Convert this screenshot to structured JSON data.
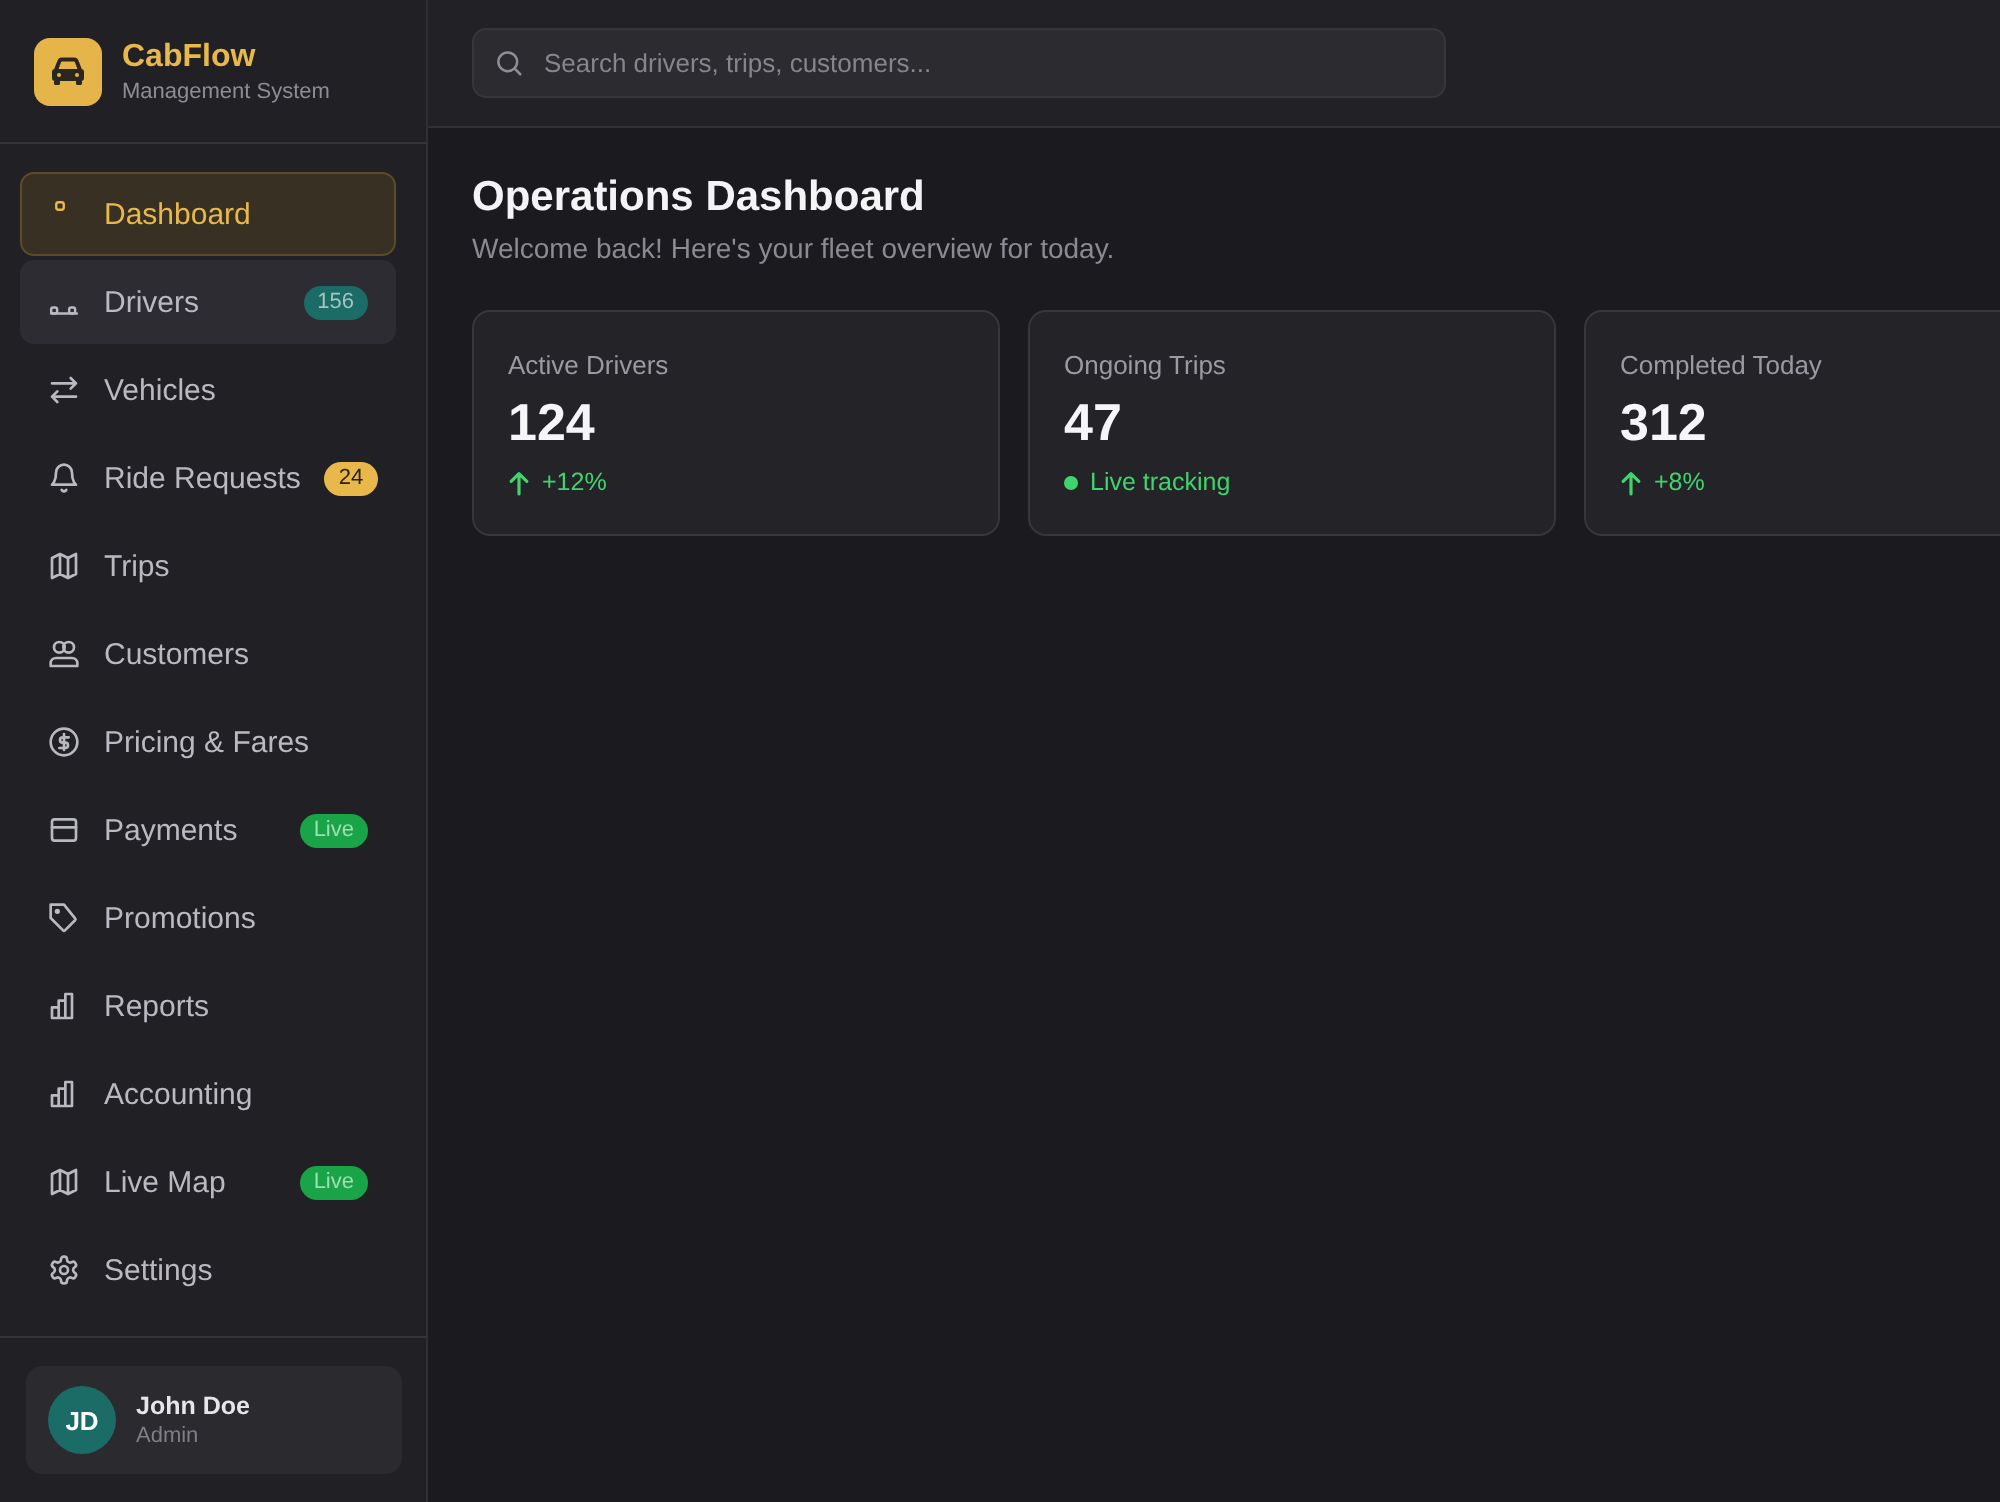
{
  "brand": {
    "name": "CabFlow",
    "subtitle": "Management System"
  },
  "sidebar": {
    "items": [
      {
        "label": "Dashboard",
        "selected": true,
        "hovered": false
      },
      {
        "label": "Drivers",
        "selected": false,
        "hovered": true,
        "badge": {
          "text": "156",
          "color": "#1b6b67"
        }
      },
      {
        "label": "Vehicles",
        "selected": false,
        "hovered": false
      },
      {
        "label": "Ride Requests",
        "selected": false,
        "hovered": false,
        "badge": {
          "text": "24",
          "color": "#e8b84a"
        }
      },
      {
        "label": "Trips",
        "selected": false,
        "hovered": false
      },
      {
        "label": "Customers",
        "selected": false,
        "hovered": false
      },
      {
        "label": "Pricing & Fares",
        "selected": false,
        "hovered": false
      },
      {
        "label": "Payments",
        "selected": false,
        "hovered": false,
        "badge": {
          "text": "Live",
          "color": "#18a447"
        }
      },
      {
        "label": "Promotions",
        "selected": false,
        "hovered": false
      },
      {
        "label": "Reports",
        "selected": false,
        "hovered": false
      },
      {
        "label": "Accounting",
        "selected": false,
        "hovered": false
      },
      {
        "label": "Live Map",
        "selected": false,
        "hovered": false,
        "badge": {
          "text": "Live",
          "color": "#18a447"
        }
      },
      {
        "label": "Settings",
        "selected": false,
        "hovered": false
      }
    ]
  },
  "user": {
    "initials": "JD",
    "name": "John Doe",
    "role": "Admin"
  },
  "search": {
    "placeholder": "Search drivers, trips, customers..."
  },
  "page": {
    "title": "Operations Dashboard",
    "subtitle": "Welcome back! Here's your fleet overview for today."
  },
  "stats": [
    {
      "label": "Active Drivers",
      "value": "124",
      "change": {
        "kind": "up",
        "text": "+12%"
      }
    },
    {
      "label": "Ongoing Trips",
      "value": "47",
      "change": {
        "kind": "live",
        "text": "Live tracking"
      }
    },
    {
      "label": "Completed Today",
      "value": "312",
      "change": {
        "kind": "up",
        "text": "+8%"
      }
    }
  ]
}
